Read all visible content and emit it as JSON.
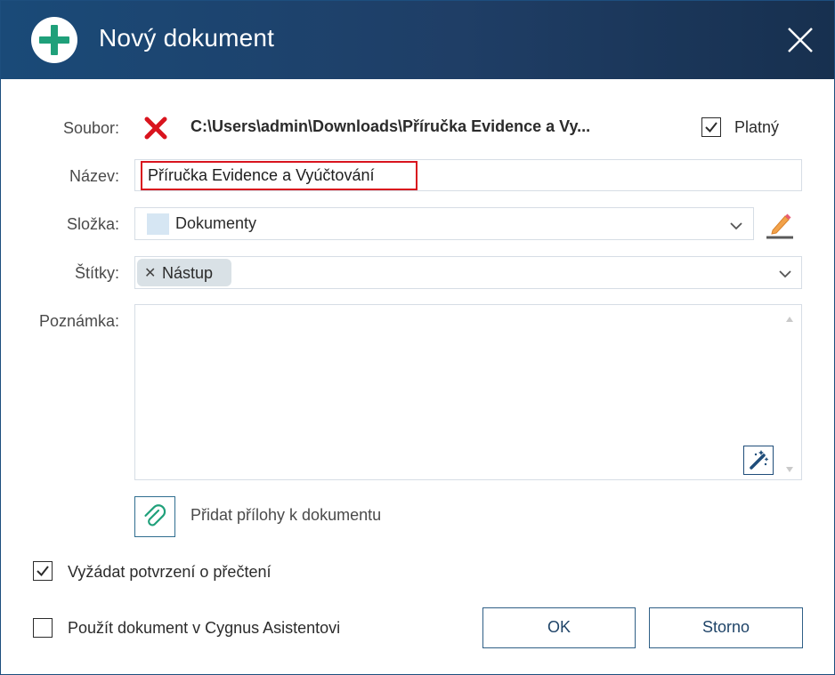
{
  "dialog": {
    "title": "Nový dokument",
    "title_icon": "plus-circle-icon",
    "close_icon": "close-icon"
  },
  "form": {
    "file": {
      "label": "Soubor:",
      "status_icon": "invalid-x-icon",
      "path": "C:\\Users\\admin\\Downloads\\Příručka Evidence a Vy..."
    },
    "valid": {
      "label": "Platný",
      "checked": true
    },
    "name": {
      "label": "Název:",
      "value": "Příručka Evidence a Vyúčtování"
    },
    "folder": {
      "label": "Složka:",
      "value": "Dokumenty",
      "edit_icon": "pencil-icon"
    },
    "tags": {
      "label": "Štítky:",
      "items": [
        "Nástup"
      ]
    },
    "note": {
      "label": "Poznámka:",
      "value": "",
      "tool_icon": "magic-wand-icon"
    },
    "attachments": {
      "label": "Přidat přílohy k dokumentu",
      "icon": "paperclip-icon"
    },
    "read_receipt": {
      "label": "Vyžádat potvrzení o přečtení",
      "checked": true
    },
    "assistant": {
      "label": "Použít dokument v Cygnus Asistentovi",
      "checked": false
    }
  },
  "buttons": {
    "ok": "OK",
    "cancel": "Storno"
  },
  "colors": {
    "titlebar": "#1f3e66",
    "accent_green": "#1fa07a",
    "error_red": "#d9141e",
    "border": "#2f5f86"
  }
}
